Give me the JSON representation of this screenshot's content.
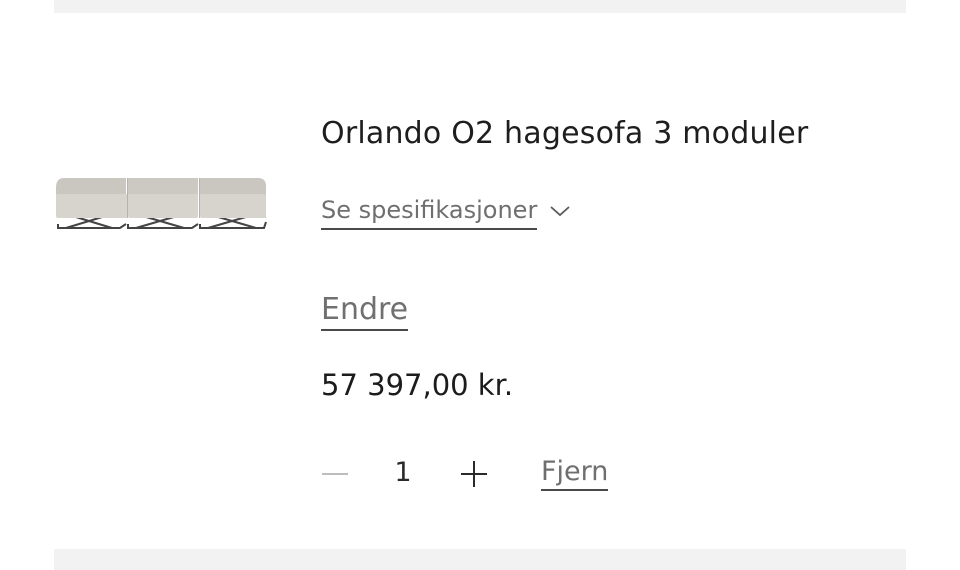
{
  "cart_item": {
    "title": "Orlando O2 hagesofa 3 moduler",
    "specs_label": "Se spesifikasjoner",
    "edit_label": "Endre",
    "price": "57 397,00 kr.",
    "quantity": "1",
    "remove_label": "Fjern"
  },
  "icons": {
    "specs_toggle": "chevron-down-icon",
    "decrease": "minus-icon",
    "increase": "plus-icon"
  },
  "colors": {
    "text": "#1c1c1c",
    "muted_text": "#6f6f6f",
    "underline": "#4a4a4a",
    "band": "#f2f2f2",
    "sofa_fabric": "#d3d1ca"
  }
}
